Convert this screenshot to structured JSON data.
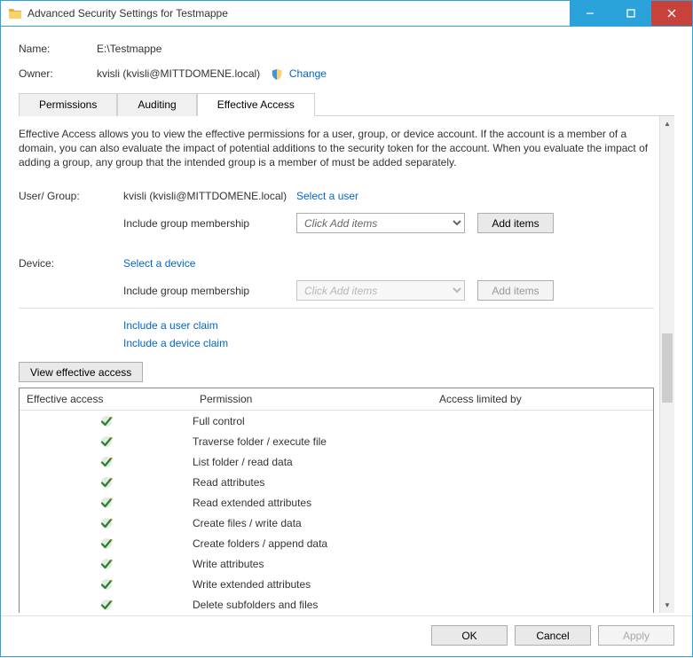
{
  "title": "Advanced Security Settings for Testmappe",
  "name_label": "Name:",
  "name_value": "E:\\Testmappe",
  "owner_label": "Owner:",
  "owner_value": "kvisli (kvisli@MITTDOMENE.local)",
  "owner_change": "Change",
  "tabs": {
    "permissions": "Permissions",
    "auditing": "Auditing",
    "effective": "Effective Access"
  },
  "description": "Effective Access allows you to view the effective permissions for a user, group, or device account. If the account is a member of a domain, you can also evaluate the impact of potential additions to the security token for the account. When you evaluate the impact of adding a group, any group that the intended group is a member of must be added separately.",
  "user_group_label": "User/ Group:",
  "user_group_value": "kvisli (kvisli@MITTDOMENE.local)",
  "select_user": "Select a user",
  "include_group_label": "Include group membership",
  "dd_placeholder": "Click Add items",
  "add_items": "Add items",
  "device_label": "Device:",
  "select_device": "Select a device",
  "include_user_claim": "Include a user claim",
  "include_device_claim": "Include a device claim",
  "view_effective": "View effective access",
  "cols": {
    "ea": "Effective access",
    "perm": "Permission",
    "alb": "Access limited by"
  },
  "permissions_list": [
    "Full control",
    "Traverse folder / execute file",
    "List folder / read data",
    "Read attributes",
    "Read extended attributes",
    "Create files / write data",
    "Create folders / append data",
    "Write attributes",
    "Write extended attributes",
    "Delete subfolders and files"
  ],
  "footer": {
    "ok": "OK",
    "cancel": "Cancel",
    "apply": "Apply"
  }
}
